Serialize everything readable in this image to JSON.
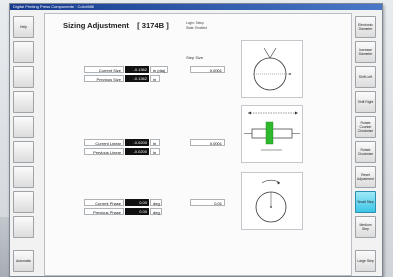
{
  "window": {
    "title": "Digital Printing Press Components · Color/Mill"
  },
  "header": {
    "title": "Sizing Adjustment",
    "code": "[ 3174B ]",
    "sub1": "Login: Setup",
    "sub2": "State: Enabled"
  },
  "left_buttons": [
    "Help",
    "",
    "",
    "",
    "",
    "",
    "",
    "",
    "",
    "",
    "Automatic"
  ],
  "right_buttons": [
    "Electronic Diameter",
    "Increase Diameter",
    "Shift Left",
    "Shift Right",
    "Rotate Counter Clockwise",
    "Rotate Clockwise",
    "Reset Adjustment",
    "Small Step",
    "Medium Step",
    "Large Step"
  ],
  "active_button": "Small Step",
  "step_size_label": "Step Size",
  "rows": [
    {
      "current_label": "Current Size",
      "current_value": "-0.1362",
      "unit": "in (dia)",
      "previous_label": "Previous Size",
      "previous_value": "-0.1362",
      "previous_unit": "in",
      "step": "0.0001"
    },
    {
      "current_label": "Current Linear",
      "current_value": "-0.0200",
      "unit": "in",
      "previous_label": "Previous Linear",
      "previous_value": "-0.0200",
      "previous_unit": "in",
      "step": "0.0001"
    },
    {
      "current_label": "Current Phase",
      "current_value": "0.00",
      "unit": "deg",
      "previous_label": "Previous Phase",
      "previous_value": "0.00",
      "previous_unit": "deg",
      "step": "0.01"
    }
  ],
  "colors": {
    "active": "#3cc5e6",
    "value_bg": "#111111",
    "green_bar": "#2eb82e"
  }
}
